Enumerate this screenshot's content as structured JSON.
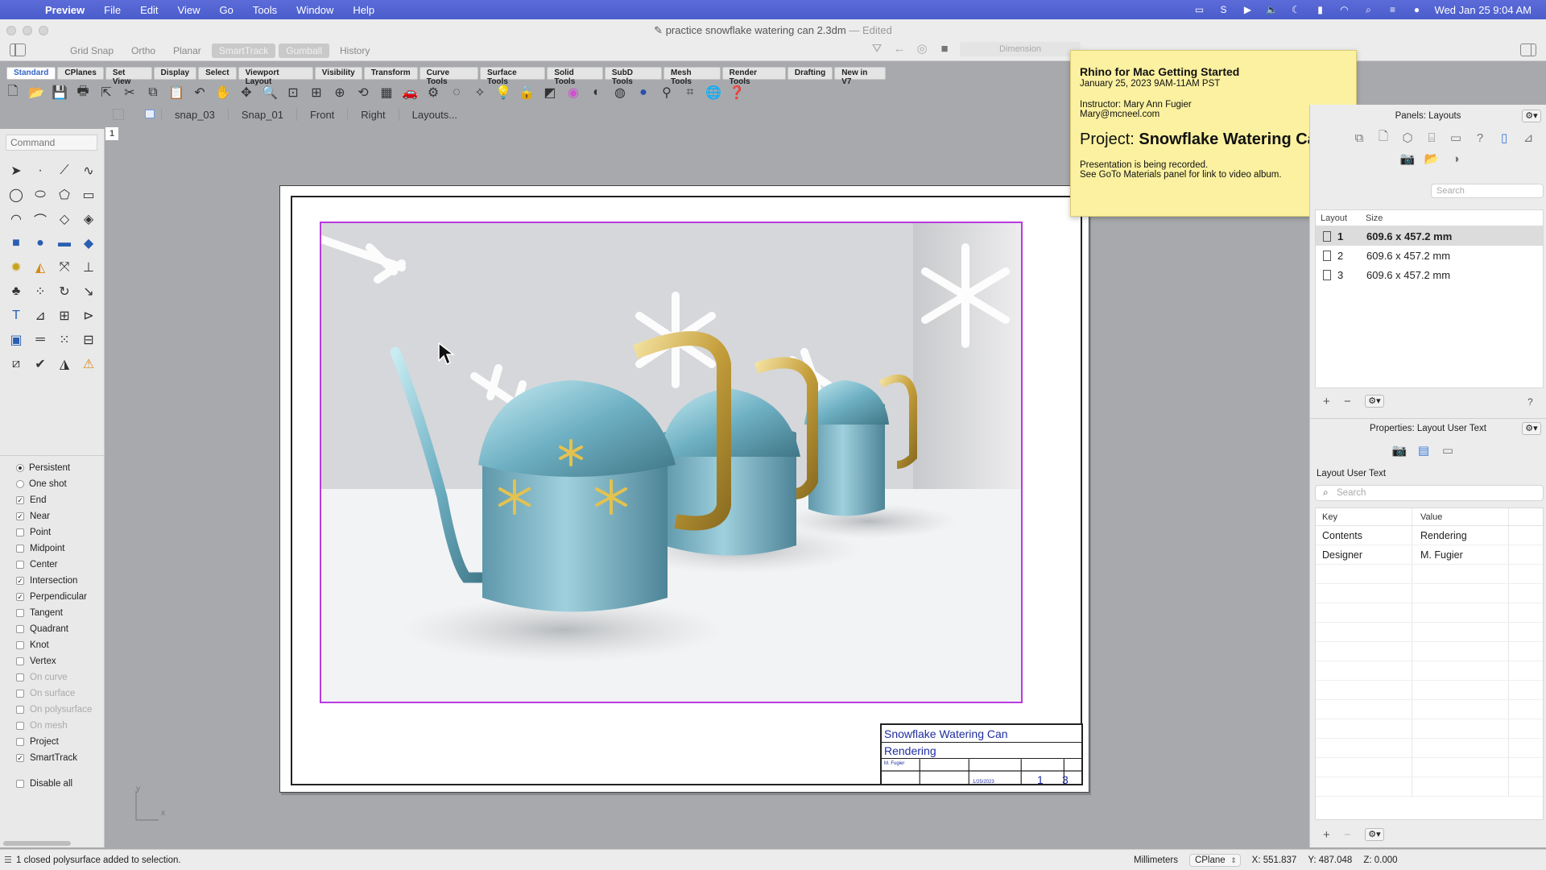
{
  "menubar": {
    "app": "Preview",
    "items": [
      "File",
      "Edit",
      "View",
      "Go",
      "Tools",
      "Window",
      "Help"
    ],
    "datetime": "Wed Jan 25  9:04 AM"
  },
  "window": {
    "title": "practice snowflake watering can 2.3dm",
    "edited": "— Edited"
  },
  "modes": {
    "grid_snap": "Grid Snap",
    "ortho": "Ortho",
    "planar": "Planar",
    "smarttrack": "SmartTrack",
    "gumball": "Gumball",
    "history": "History"
  },
  "dimension": {
    "placeholder": "Dimension"
  },
  "tabs": [
    "Standard",
    "CPlanes",
    "Set View",
    "Display",
    "Select",
    "Viewport Layout",
    "Visibility",
    "Transform",
    "Curve Tools",
    "Surface Tools",
    "Solid Tools",
    "SubD Tools",
    "Mesh Tools",
    "Render Tools",
    "Drafting",
    "New in V7"
  ],
  "viewport_tabs": [
    "snap_03",
    "Snap_01",
    "Front",
    "Right",
    "Layouts..."
  ],
  "viewport_number": "1",
  "command": {
    "placeholder": "Command"
  },
  "osnap": {
    "persistent": "Persistent",
    "one_shot": "One shot",
    "items": [
      {
        "label": "End",
        "checked": true,
        "enabled": true
      },
      {
        "label": "Near",
        "checked": true,
        "enabled": true
      },
      {
        "label": "Point",
        "checked": false,
        "enabled": true
      },
      {
        "label": "Midpoint",
        "checked": false,
        "enabled": true
      },
      {
        "label": "Center",
        "checked": false,
        "enabled": true
      },
      {
        "label": "Intersection",
        "checked": true,
        "enabled": true
      },
      {
        "label": "Perpendicular",
        "checked": true,
        "enabled": true
      },
      {
        "label": "Tangent",
        "checked": false,
        "enabled": true
      },
      {
        "label": "Quadrant",
        "checked": false,
        "enabled": true
      },
      {
        "label": "Knot",
        "checked": false,
        "enabled": true
      },
      {
        "label": "Vertex",
        "checked": false,
        "enabled": true
      },
      {
        "label": "On curve",
        "checked": false,
        "enabled": false
      },
      {
        "label": "On surface",
        "checked": false,
        "enabled": false
      },
      {
        "label": "On polysurface",
        "checked": false,
        "enabled": false
      },
      {
        "label": "On mesh",
        "checked": false,
        "enabled": false
      },
      {
        "label": "Project",
        "checked": false,
        "enabled": true
      },
      {
        "label": "SmartTrack",
        "checked": true,
        "enabled": true
      }
    ],
    "disable_all": "Disable all"
  },
  "axis": {
    "x": "x",
    "y": "y"
  },
  "note": {
    "title": "Rhino for Mac Getting Started",
    "date": "January 25, 2023 9AM-11AM PST",
    "instructor": "Instructor: Mary Ann Fugier",
    "email": "Mary@mcneel.com",
    "project_label": "Project:",
    "project_name": "Snowflake Watering Can",
    "recording": "Presentation is being recorded.",
    "goto": "See GoTo Materials panel for link to video album."
  },
  "titleblock": {
    "title": "Snowflake Watering Can",
    "contents": "Rendering",
    "designer": "M. Fugier",
    "date": "1/25/2023",
    "page": "1",
    "page_count": "3"
  },
  "layouts_panel": {
    "title": "Panels: Layouts",
    "search_placeholder": "Search",
    "columns": [
      "Layout",
      "Size"
    ],
    "rows": [
      {
        "num": "1",
        "size": "609.6 x 457.2 mm"
      },
      {
        "num": "2",
        "size": "609.6 x 457.2 mm"
      },
      {
        "num": "3",
        "size": "609.6 x 457.2 mm"
      }
    ]
  },
  "properties_panel": {
    "title": "Properties: Layout User Text",
    "section": "Layout User Text",
    "search_placeholder": "Search",
    "columns": [
      "Key",
      "Value"
    ],
    "rows": [
      {
        "key": "Contents",
        "value": "Rendering"
      },
      {
        "key": "Designer",
        "value": "M. Fugier"
      }
    ]
  },
  "statusbar": {
    "message": "1 closed polysurface added to selection.",
    "units": "Millimeters",
    "cplane": "CPlane",
    "x": "X: 551.837",
    "y": "Y: 487.048",
    "z": "Z: 0.000"
  },
  "colors": {
    "menubar": "#4a5dcc",
    "detail_border": "#b93ae0",
    "titleblock_text": "#1e2da0",
    "note": "#fbf1a0",
    "can_body": "#7cb4c6",
    "can_handle": "#c9a84a"
  }
}
